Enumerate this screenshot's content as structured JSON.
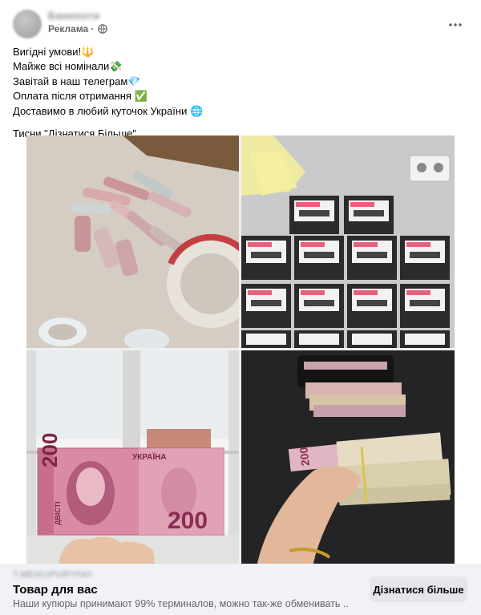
{
  "header": {
    "page_name": "Банкноти",
    "sponsored_label": "Реклама ·",
    "more_icon": "more-horizontal-icon",
    "audience_icon": "globe-icon"
  },
  "post": {
    "lines": [
      "Вигідні умови!🔱",
      "Майже всі номінали💸",
      "Завітай в наш телеграм💎",
      "Оплата після отримання ✅",
      "Доставимо в любий куточок України 🌐"
    ],
    "cta_line": "Тисни \"Дізнатися Більше\""
  },
  "images": {
    "top_left": "rolled-banknotes-photo",
    "top_right": "sealed-packets-photo",
    "bottom_left": "banknote-200-at-window-photo",
    "bottom_right": "wallet-with-cash-photo",
    "banknote_value": "200",
    "banknote_country": "УКРАЇНА",
    "banknote_word": "ДВІСТІ"
  },
  "footer": {
    "domain": "t.me/kupurypay",
    "title": "Товар для вас",
    "description": "Наши купюры принимают 99% терминалов, можно так-же обменивать ...",
    "button_label": "Дізнатися більше"
  },
  "colors": {
    "background": "#ffffff",
    "footer_background": "#f0f2f5",
    "button_background": "#e4e6eb",
    "secondary_text": "#65676b"
  }
}
